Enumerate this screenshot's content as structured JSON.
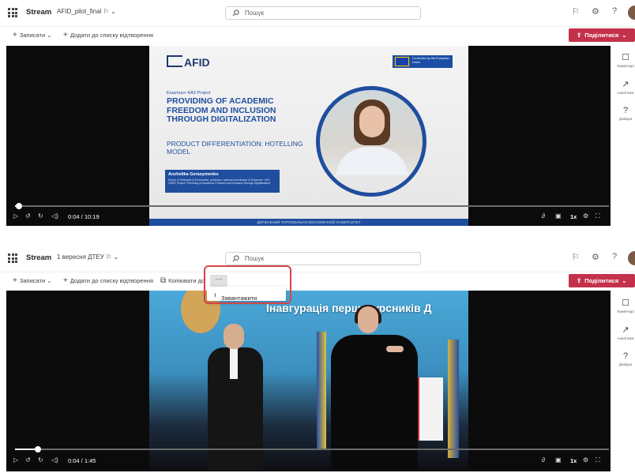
{
  "colors": {
    "accent": "#c4314b",
    "highlight": "#d64545",
    "slide_blue": "#1f4e9e"
  },
  "panel1": {
    "app_name": "Stream",
    "file_name": "AFID_pilot_final",
    "share_glyph": "⚐",
    "search_placeholder": "Пошук",
    "top_icons": [
      "feedback-icon",
      "gear-icon",
      "help-icon"
    ],
    "commands": {
      "record": "Записати",
      "add_playlist": "Додати до списку відтворення"
    },
    "share_label": "Поділитися",
    "slide": {
      "logo": "AFID",
      "eu_text": "Co-funded by the European Union",
      "project": "Erasmus+ KA2 Project",
      "title": "PROVIDING OF ACADEMIC FREEDOM AND INCLUSION THROUGH DIGITALIZATION",
      "subtitle": "PRODUCT DIFFERENTIATION: HOTELLING MODEL",
      "presenter": "Anzhelika Gerasymenko",
      "presenter_desc": "Doctor of Sciences in Economics, professor, national coordinator of Erasmus+ KA2 CBHE Project \"Providing of Academic Freedom and Inclusion through Digitalization\"",
      "footer": "ДЕРЖАВНИЙ ТОРГОВЕЛЬНО-ЕКОНОМІЧНИЙ УНІВЕРСИТЕТ"
    },
    "time": "0:04 / 10:19",
    "progress_fraction": 0.006,
    "speed": "1x",
    "rail": [
      "Коментарі",
      "Аналітика",
      "Довідка"
    ]
  },
  "panel2": {
    "app_name": "Stream",
    "file_name": "1 вересня ДТЕУ",
    "share_glyph": "⚐",
    "search_placeholder": "Пошук",
    "commands": {
      "record": "Записати",
      "add_playlist": "Додати до списку відтворення",
      "copy": "Копіювати до"
    },
    "more": "···",
    "dropdown_item": "Завантажити",
    "share_label": "Поділитися",
    "video_banner": "Інавгурація першокурсників Д",
    "time": "0:04 / 1:45",
    "progress_fraction": 0.038,
    "speed": "1x",
    "rail": [
      "Коментарі",
      "Аналітика",
      "Довідка"
    ]
  }
}
